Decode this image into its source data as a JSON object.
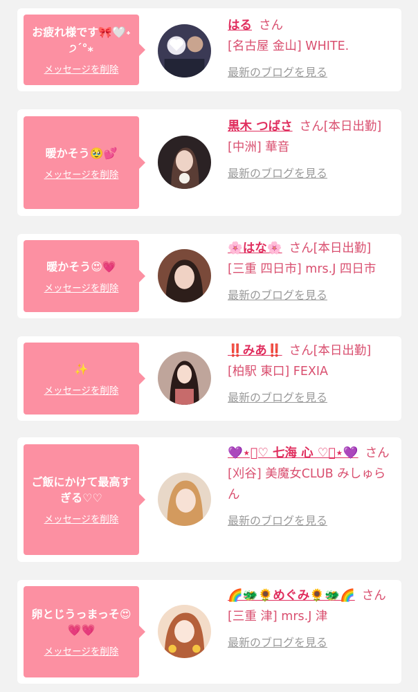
{
  "colors": {
    "page_background": "#f2f2f2",
    "bubble": "#fc90a2",
    "name": "#e02e5e",
    "text": "#d94f6f",
    "link_gray": "#9a9a9a"
  },
  "delete_label": "メッセージを削除",
  "blog_label": "最新のブログを見る",
  "items": [
    {
      "message": "お疲れ様です🎀🤍˖ ੭ˊ°⁎",
      "name": "はる",
      "honorific": "さん",
      "status": "",
      "shop": "[名古屋 金山] WHITE."
    },
    {
      "message": "暖かそう🥹💕",
      "name": "黒木 つばさ",
      "honorific": "さん",
      "status": "[本日出勤]",
      "shop": "[中洲] 華音"
    },
    {
      "message": "暖かそう😍💗",
      "name": "🌸はな🌸",
      "honorific": "さん",
      "status": "[本日出勤]",
      "shop": "[三重 四日市] mrs.J 四日市"
    },
    {
      "message": "✨",
      "name": "‼️みあ‼️",
      "honorific": "さん",
      "status": "[本日出勤]",
      "shop": "[柏駅 東口] FEXIA"
    },
    {
      "message": "ご飯にかけて最高すぎる♡♡",
      "name": "💜⋆͛♡ 七海 心 ♡͛⋆💜",
      "honorific": "さん",
      "status": "",
      "shop": "[刈谷] 美魔女CLUB みしゅらん"
    },
    {
      "message": "卵とじうっまっそ😍💗💗",
      "name": "🌈🐲🌻めぐみ🌻🐲🌈",
      "honorific": "さん",
      "status": "",
      "shop": "[三重 津] mrs.J 津"
    }
  ]
}
